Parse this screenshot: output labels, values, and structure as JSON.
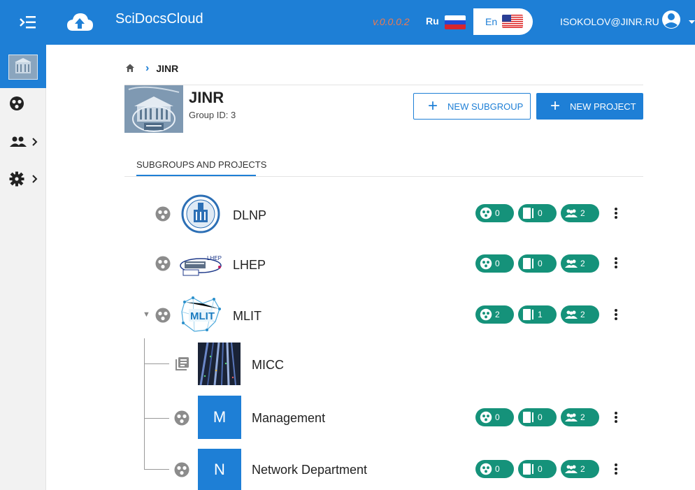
{
  "app": {
    "title": "SciDocsCloud",
    "version": "v.0.0.0.2",
    "lang_ru": "Ru",
    "lang_en": "En",
    "user_email": "ISOKOLOV@JINR.RU",
    "brand_color": "#1e7fd6",
    "badge_color": "#15927a"
  },
  "breadcrumb": {
    "home_icon": "home-icon",
    "items": [
      "JINR"
    ]
  },
  "group": {
    "name": "JINR",
    "id_label": "Group ID: 3"
  },
  "actions": {
    "new_subgroup": "NEW SUBGROUP",
    "new_project": "NEW PROJECT"
  },
  "tabs": [
    "SUBGROUPS AND PROJECTS"
  ],
  "rows": [
    {
      "type": "group",
      "name": "DLNP",
      "expanded": false,
      "badges": {
        "subgroups": "0",
        "projects": "0",
        "members": "2"
      }
    },
    {
      "type": "group",
      "name": "LHEP",
      "expanded": false,
      "badges": {
        "subgroups": "0",
        "projects": "0",
        "members": "2"
      }
    },
    {
      "type": "group",
      "name": "MLIT",
      "expanded": true,
      "badges": {
        "subgroups": "2",
        "projects": "1",
        "members": "2"
      }
    },
    {
      "type": "project",
      "name": "MICC"
    },
    {
      "type": "group",
      "name": "Management",
      "tile_letter": "M",
      "badges": {
        "subgroups": "0",
        "projects": "0",
        "members": "2"
      }
    },
    {
      "type": "group",
      "name": "Network Department",
      "tile_letter": "N",
      "badges": {
        "subgroups": "0",
        "projects": "0",
        "members": "2"
      }
    }
  ]
}
